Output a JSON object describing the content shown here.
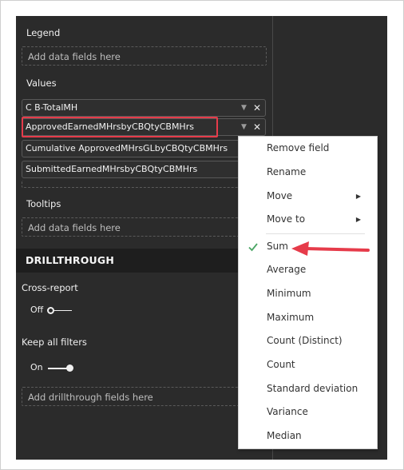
{
  "fields_pane": {
    "legend": {
      "title": "Legend",
      "placeholder": "Add data fields here"
    },
    "values": {
      "title": "Values",
      "fields": [
        "C B-TotalMH",
        "ApprovedEarnedMHrsbyCBQtyCBMHrs",
        "Cumulative ApprovedMHrsGLbyCBQtyCBMHrs",
        "SubmittedEarnedMHrsbyCBQtyCBMHrs"
      ]
    },
    "tooltips": {
      "title": "Tooltips",
      "placeholder": "Add data fields here"
    },
    "drillthrough": {
      "title": "DRILLTHROUGH",
      "cross_report": {
        "label": "Cross-report",
        "state": "Off"
      },
      "keep_all_filters": {
        "label": "Keep all filters",
        "state": "On"
      },
      "placeholder": "Add drillthrough fields here"
    }
  },
  "context_menu": {
    "items": [
      "Remove field",
      "Rename",
      "Move",
      "Move to",
      "Sum",
      "Average",
      "Minimum",
      "Maximum",
      "Count (Distinct)",
      "Count",
      "Standard deviation",
      "Variance",
      "Median"
    ],
    "checked_item": "Sum",
    "submenu_items": [
      "Move",
      "Move to"
    ]
  },
  "icons": {
    "remove": "close-icon",
    "expand": "chevron-down-icon",
    "submenu": "caret-right-icon",
    "checked": "checkmark-icon",
    "callout": "red-arrow-icon"
  },
  "colors": {
    "pane_bg": "#2b2b2b",
    "highlight": "#e63b4a",
    "check": "#4aa564",
    "callout_arrow": "#e63b4a"
  }
}
